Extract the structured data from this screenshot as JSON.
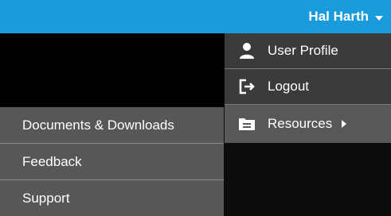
{
  "header": {
    "user_name": "Hal Harth",
    "accent_color": "#1a9bdc"
  },
  "user_menu": {
    "items": [
      {
        "label": "User Profile",
        "icon": "user-icon"
      },
      {
        "label": "Logout",
        "icon": "logout-icon"
      },
      {
        "label": "Resources",
        "icon": "folder-icon",
        "has_submenu": true,
        "active": true
      }
    ]
  },
  "resources_menu": {
    "items": [
      {
        "label": "Documents & Downloads"
      },
      {
        "label": "Feedback"
      },
      {
        "label": "Support"
      }
    ]
  }
}
